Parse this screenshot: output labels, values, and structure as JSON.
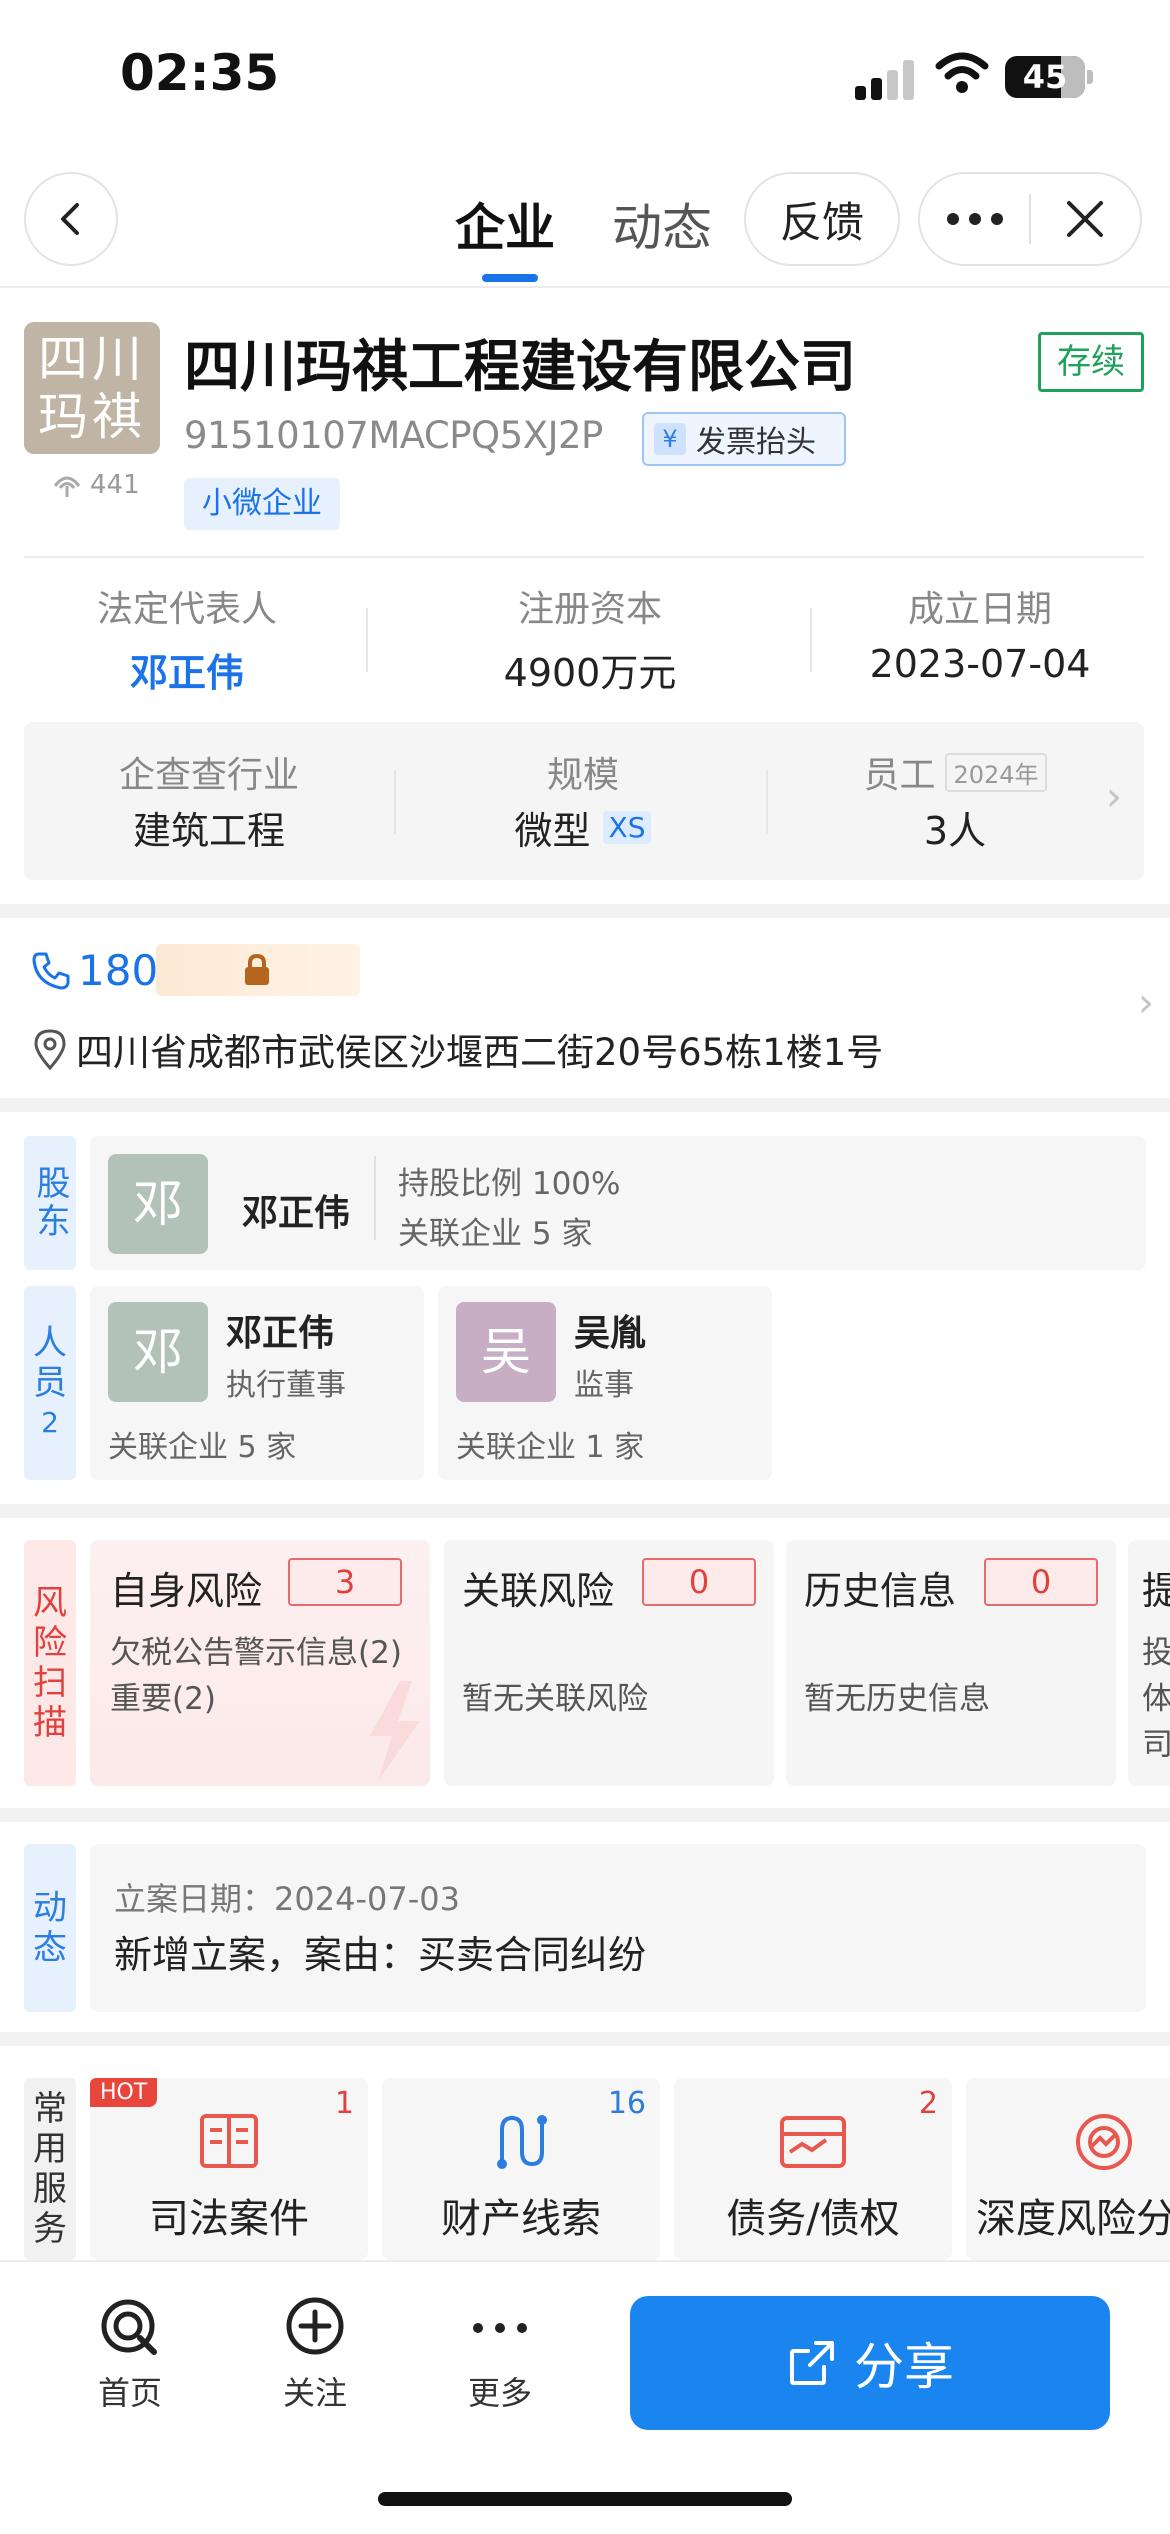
{
  "status_bar": {
    "time": "02:35",
    "battery": "45"
  },
  "nav": {
    "tabs": [
      {
        "label": "企业",
        "active": true
      },
      {
        "label": "动态",
        "active": false
      }
    ],
    "feedback": "反馈"
  },
  "company": {
    "logo_line1": "四川",
    "logo_line2": "玛祺",
    "views": "441",
    "name": "四川玛祺工程建设有限公司",
    "status": "存续",
    "credit_code": "91510107MACPQ5XJ2P",
    "invoice_label": "发票抬头",
    "size_tag": "小微企业"
  },
  "key_info": [
    {
      "label": "法定代表人",
      "value": "邓正伟"
    },
    {
      "label": "注册资本",
      "value": "4900万元"
    },
    {
      "label": "成立日期",
      "value": "2023-07-04"
    }
  ],
  "industry_info": {
    "industry_label": "企查查行业",
    "industry_value": "建筑工程",
    "scale_label": "规模",
    "scale_value": "微型",
    "scale_badge": "XS",
    "staff_label": "员工",
    "staff_year": "2024年",
    "staff_value": "3人"
  },
  "contact": {
    "phone": "180",
    "address": "四川省成都市武侯区沙堰西二街20号65栋1楼1号"
  },
  "shareholder": {
    "tag": "股东",
    "avatar": "邓",
    "name": "邓正伟",
    "ratio": "持股比例 100%",
    "related": "关联企业 5 家"
  },
  "personnel": {
    "tag_chars": [
      "人",
      "员"
    ],
    "count": "2",
    "people": [
      {
        "avatar": "邓",
        "name": "邓正伟",
        "role": "执行董事",
        "related": "关联企业 5 家"
      },
      {
        "avatar": "吴",
        "name": "吴胤",
        "role": "监事",
        "related": "关联企业 1 家"
      }
    ]
  },
  "risk": {
    "tag_chars": [
      "风",
      "险",
      "扫",
      "描"
    ],
    "cards": [
      {
        "title": "自身风险",
        "count": "3",
        "desc1": "欠税公告警示信息(2)",
        "desc2": "重要(2)"
      },
      {
        "title": "关联风险",
        "count": "0",
        "desc1": "暂无关联风险",
        "desc2": ""
      },
      {
        "title": "历史信息",
        "count": "0",
        "desc1": "暂无历史信息",
        "desc2": ""
      }
    ],
    "partial_title": "提",
    "partial_lines": [
      "投",
      "体",
      "司"
    ]
  },
  "dynamic": {
    "tag_chars": [
      "动",
      "态"
    ],
    "date": "立案日期：2024-07-03",
    "text": "新增立案，案由：买卖合同纠纷"
  },
  "services": {
    "tag_chars": [
      "常",
      "用",
      "服",
      "务"
    ],
    "hot": "HOT",
    "items": [
      {
        "label": "司法案件",
        "count": "1",
        "count_color": "#e0413c"
      },
      {
        "label": "财产线索",
        "count": "16",
        "count_color": "#2b7de0"
      },
      {
        "label": "债务/债权",
        "count": "2",
        "count_color": "#e0413c"
      },
      {
        "label": "深度风险分",
        "count": "",
        "count_color": "#e0413c"
      }
    ]
  },
  "bottom_nav": {
    "home": "首页",
    "follow": "关注",
    "more": "更多",
    "share": "分享"
  },
  "colors": {
    "accent": "#1a73e8",
    "status_green": "#1ea15b",
    "risk_red": "#e0413c"
  }
}
